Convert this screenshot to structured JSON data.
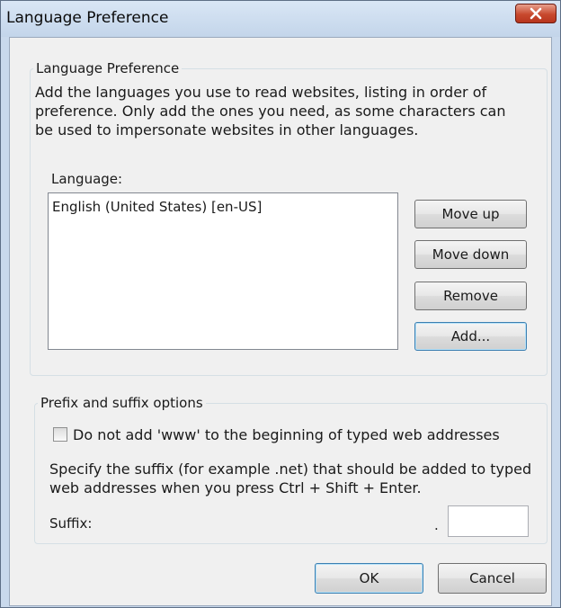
{
  "window": {
    "title": "Language Preference"
  },
  "icons": {
    "close": "close-icon"
  },
  "language_group": {
    "legend": "Language Preference",
    "intro": "Add the languages you use to read websites, listing in order of preference. Only add the ones you need, as some characters can be used to impersonate websites in other languages.",
    "list_label": "Language:",
    "languages": [
      "English (United States) [en-US]"
    ],
    "buttons": {
      "move_up": "Move up",
      "move_down": "Move down",
      "remove": "Remove",
      "add": "Add..."
    }
  },
  "prefix_group": {
    "legend": "Prefix and suffix options",
    "checkbox_label": "Do not add 'www' to the beginning of typed web addresses",
    "checkbox_checked": false,
    "suffix_description": "Specify the suffix (for example .net) that should be added to typed web addresses when you press Ctrl + Shift + Enter.",
    "suffix_label": "Suffix:",
    "suffix_dot": ".",
    "suffix_value": ""
  },
  "footer": {
    "ok": "OK",
    "cancel": "Cancel"
  },
  "colors": {
    "frame": "#c9d9ec",
    "client": "#f0f0f0",
    "close_button": "#c8492e",
    "default_button_border": "#3c7fb1"
  }
}
